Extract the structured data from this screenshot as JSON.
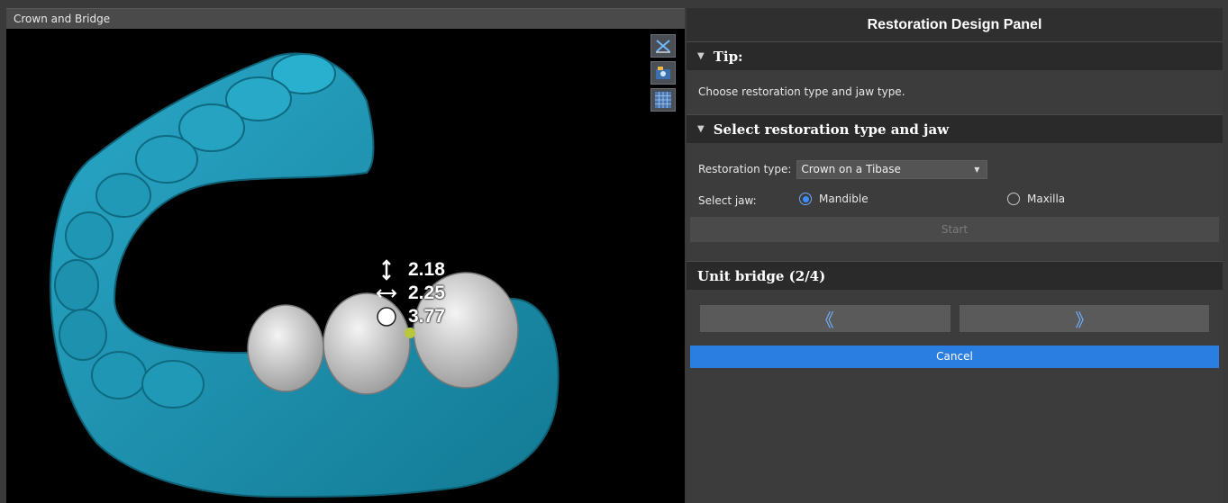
{
  "viewport": {
    "title": "Crown and Bridge",
    "tools": [
      {
        "icon": "measure-cross-icon"
      },
      {
        "icon": "snapshot-icon"
      },
      {
        "icon": "grid-icon"
      }
    ],
    "measurements": [
      {
        "icon": "vertical-arrow-icon",
        "value": "2.18"
      },
      {
        "icon": "horizontal-arrow-icon",
        "value": "2.25"
      },
      {
        "icon": "circle-icon",
        "value": "3.77"
      }
    ],
    "colors": {
      "jaw": "#1f9bb8",
      "teeth": "#d9d9d9",
      "background": "#000000"
    }
  },
  "panel": {
    "title": "Restoration Design Panel",
    "tip": {
      "header": "Tip:",
      "text": "Choose restoration type and jaw type."
    },
    "select_section": {
      "header": "Select restoration type and jaw",
      "restoration_label": "Restoration type:",
      "restoration_value": "Crown on a Tibase",
      "jaw_label": "Select jaw:",
      "jaw_options": [
        {
          "label": "Mandible",
          "selected": true
        },
        {
          "label": "Maxilla",
          "selected": false
        }
      ],
      "start_label": "Start"
    },
    "unit_section": {
      "header": "Unit bridge (2/4)",
      "prev_symbol": "《",
      "next_symbol": "》",
      "cancel_label": "Cancel"
    },
    "colors": {
      "accent": "#2a7de1",
      "background": "#3c3c3c"
    }
  }
}
